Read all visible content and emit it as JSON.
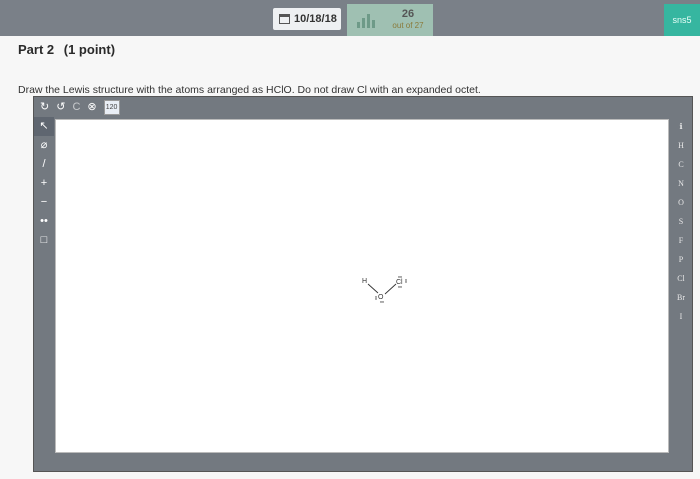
{
  "topbar": {
    "date": "10/18/18",
    "score": "26",
    "score_sub": "out of 27",
    "user": "sns5"
  },
  "part": {
    "title": "Part 2",
    "points": "(1 point)"
  },
  "question": "Draw the Lewis structure with the atoms arranged as HClO. Do not draw Cl with an expanded octet.",
  "editor": {
    "top_toolbar": [
      "undo",
      "redo",
      "clear",
      "zoom-out",
      "templates"
    ],
    "top_toolbar_glyphs": [
      "↻",
      "↺",
      "C",
      "⊗",
      "120"
    ],
    "left_tools": [
      "↖",
      "⌀",
      "/",
      "+",
      "−",
      "••",
      "□"
    ],
    "right_elements": [
      "H",
      "C",
      "N",
      "O",
      "S",
      "F",
      "P",
      "Cl",
      "Br",
      "I"
    ],
    "right_header": "ℹ"
  },
  "molecule": {
    "atoms": [
      "H",
      "O",
      "Cl"
    ]
  }
}
